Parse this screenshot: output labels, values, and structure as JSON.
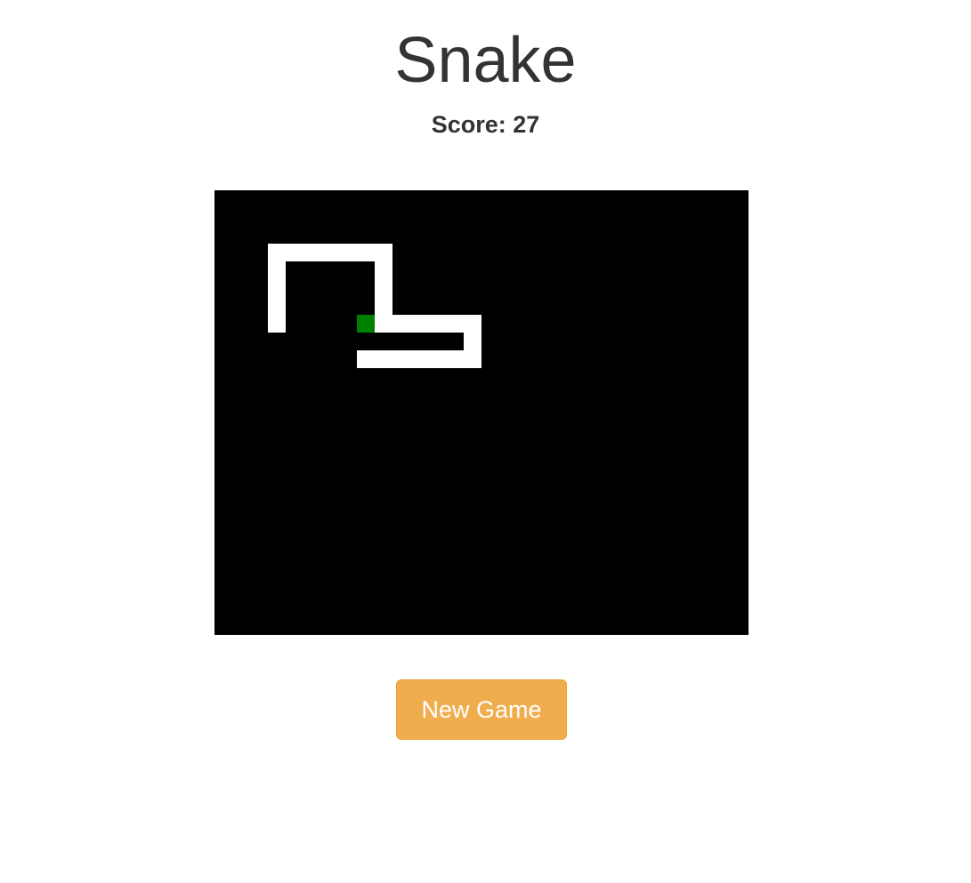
{
  "title": "Snake",
  "score_text": "Score: 27",
  "button": {
    "label": "New Game"
  },
  "board": {
    "columns": 30,
    "rows": 25,
    "background_color": "#000000",
    "snake_color": "#ffffff",
    "food_color": "#008000",
    "snake": [
      [
        3,
        7
      ],
      [
        3,
        6
      ],
      [
        3,
        5
      ],
      [
        3,
        4
      ],
      [
        3,
        3
      ],
      [
        4,
        3
      ],
      [
        5,
        3
      ],
      [
        6,
        3
      ],
      [
        7,
        3
      ],
      [
        8,
        3
      ],
      [
        9,
        3
      ],
      [
        9,
        4
      ],
      [
        9,
        5
      ],
      [
        9,
        6
      ],
      [
        9,
        7
      ],
      [
        10,
        7
      ],
      [
        11,
        7
      ],
      [
        12,
        7
      ],
      [
        13,
        7
      ],
      [
        14,
        7
      ],
      [
        14,
        8
      ],
      [
        14,
        9
      ],
      [
        13,
        9
      ],
      [
        12,
        9
      ],
      [
        11,
        9
      ],
      [
        10,
        9
      ],
      [
        9,
        9
      ],
      [
        8,
        9
      ]
    ],
    "food": [
      8,
      7
    ]
  },
  "colors": {
    "button_bg": "#f0ad4e",
    "button_border": "#eea236",
    "text": "#333333"
  }
}
